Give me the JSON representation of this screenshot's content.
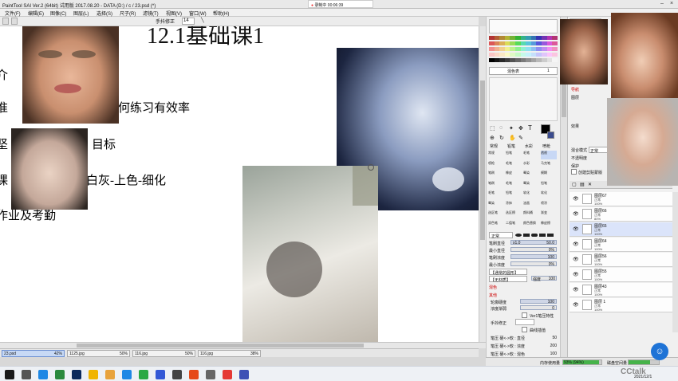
{
  "titlebar": {
    "title": "PaintTool SAI Ver.2 (64bit) 试用版 2017.08.20 - DATA (D:) / c / 23.psd (*)",
    "minimize_icon": "minimize-icon",
    "close_icon": "close-icon"
  },
  "recording": {
    "label": "录制中 00:06:39"
  },
  "menubar": {
    "items": [
      "文件(F)",
      "编辑(E)",
      "图像(C)",
      "图层(L)",
      "选择(S)",
      "尺子(R)",
      "滤镜(T)",
      "视图(V)",
      "窗口(W)",
      "帮助(H)"
    ]
  },
  "toolbar": {
    "stabilizer_label": "手抖修正",
    "stabilizer_value": "14"
  },
  "canvas": {
    "title": "12.1基础课1",
    "lines": [
      "介",
      "准",
      "何练习有效率",
      "坚",
      "目标",
      "课",
      "白灰-上色-细化",
      "作业及考勤"
    ]
  },
  "tabs": [
    {
      "name": "23.psd",
      "pct": "42%"
    },
    {
      "name": "1125.jpg",
      "pct": "50%"
    },
    {
      "name": "116.jpg",
      "pct": "50%"
    },
    {
      "name": "116.jpg",
      "pct": "38%"
    }
  ],
  "color_panel": {
    "hex_label": "混色表",
    "field_value": "1"
  },
  "tool_grid": {
    "tabs": [
      "常规",
      "铅笔",
      "水彩",
      "喷枪"
    ],
    "cells": [
      "常规",
      "铅笔",
      "毛笔",
      "透视",
      "喷枪",
      "毛笔",
      "水彩",
      "马克笔",
      "笔刷",
      "橡皮",
      "晕染",
      "模糊",
      "笔刷",
      "毛笔",
      "晕染",
      "铅笔",
      "毛笔",
      "铅笔",
      "软化",
      "软化",
      "晕染",
      "涂抹",
      "油画",
      "喷涂",
      "选区笔",
      "选区擦",
      "颜料桶",
      "渐变",
      "双色笔",
      "二值笔",
      "颜色替换",
      "橡皮擦"
    ]
  },
  "brush_settings": {
    "mode": "正常",
    "size_label": "笔刷直径",
    "size_mult": "x1.0",
    "size_value": "50.0",
    "min_size_label": "最小直径",
    "min_size_value": "0%",
    "density_label": "笔刷浓度",
    "density_value": "100",
    "min_density_label": "最小浓度",
    "min_density_value": "0%",
    "shape_label": "【通常的圆形】",
    "texture_label": "【无材质】",
    "texture_value": "强度",
    "texture_num": "100",
    "blend_section": "混色",
    "other_section": "其他",
    "outline_label": "轮廓硬度",
    "outline_value": "100",
    "fade_label": "浓度渐弱",
    "fade_value": "0",
    "ver1_label": "Ver1笔压特性",
    "stabilizer_label": "手抖修正",
    "curve_label": "曲线插值",
    "pressure1_label": "笔压 硬<->软 : 直径",
    "pressure1_value": "50",
    "pressure2_label": "笔压 硬<->软 : 浓度",
    "pressure2_value": "200",
    "pressure3_label": "笔压 硬<->软 : 混色",
    "pressure3_value": "100"
  },
  "layers_panel": {
    "nav_label": "导航",
    "props": [
      "图层",
      "效果"
    ],
    "blend_label": "混合模式",
    "blend_value": "正常",
    "opacity_label": "不透明度",
    "lock_label": "保护",
    "clip_label": "创建剪贴蒙版",
    "layers": [
      {
        "name": "图层67",
        "mode": "正常",
        "opacity": "100%"
      },
      {
        "name": "图层66",
        "mode": "正常",
        "opacity": "80%"
      },
      {
        "name": "图层65",
        "mode": "正常",
        "opacity": "100%"
      },
      {
        "name": "图层64",
        "mode": "正常",
        "opacity": "100%"
      },
      {
        "name": "图层56",
        "mode": "正常",
        "opacity": "100%"
      },
      {
        "name": "图层55",
        "mode": "正常",
        "opacity": "100%"
      },
      {
        "name": "图层43",
        "mode": "正常",
        "opacity": "100%"
      },
      {
        "name": "图层 1",
        "mode": "正常",
        "opacity": "100%"
      }
    ]
  },
  "status": {
    "memory_label": "内存使用量",
    "memory_value": "93% (94%)",
    "disk_label": "磁盘空间量",
    "disk_value": "70%"
  },
  "taskbar": {
    "date": "2021/12/1"
  },
  "watermark": {
    "text": "CCtalk"
  },
  "colors": {
    "accent": "#1e73d6",
    "selection": "#c8d8f5"
  }
}
